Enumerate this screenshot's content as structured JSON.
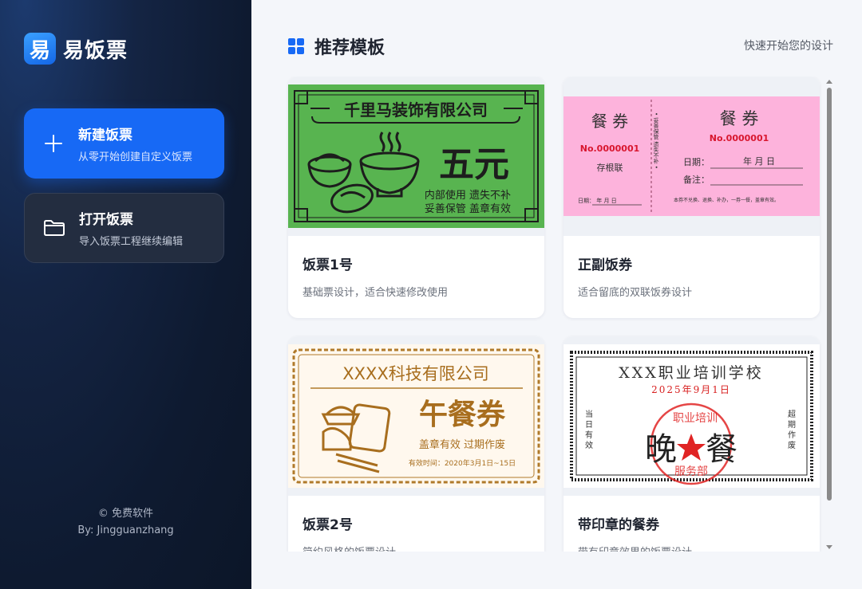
{
  "app": {
    "logo_glyph": "易",
    "name": "易饭票"
  },
  "sidebar": {
    "new_ticket": {
      "title": "新建饭票",
      "subtitle": "从零开始创建自定义饭票"
    },
    "open_ticket": {
      "title": "打开饭票",
      "subtitle": "导入饭票工程继续编辑"
    },
    "footer_line1": "© 免费软件",
    "footer_line2": "By: Jingguanzhang"
  },
  "main": {
    "title": "推荐模板",
    "hint": "快速开始您的设计",
    "templates": [
      {
        "name": "饭票1号",
        "desc": "基础票设计，适合快速修改使用",
        "preview": {
          "company": "千里马装饰有限公司",
          "amount": "五元",
          "line1": "内部使用 遗失不补",
          "line2": "妥善保管 盖章有效"
        }
      },
      {
        "name": "正副饭券",
        "desc": "适合留底的双联饭券设计",
        "preview": {
          "stub_title": "餐 券",
          "stub_no": "No.0000001",
          "stub_label": "存根联",
          "stub_date": "日期：    年  月  日",
          "side_text": "• 妥善保管 遗失不补 •",
          "main_title": "餐   券",
          "main_no": "No.0000001",
          "date_label": "日期：",
          "date_fields": "年    月    日",
          "note_label": "备注：",
          "fine_print": "本券不兑换、退换、补办，一券一餐，盖章有效。"
        }
      },
      {
        "name": "饭票2号",
        "desc": "简约风格的饭票设计",
        "preview": {
          "company": "XXXX科技有限公司",
          "title": "午餐券",
          "line1": "盖章有效 过期作废",
          "validity": "有效时间：2020年3月1日~15日"
        }
      },
      {
        "name": "带印章的餐券",
        "desc": "带有印章效果的饭票设计",
        "preview": {
          "school": "XXX职业培训学校",
          "date": "2025年9月1日",
          "left_note": "当日有效",
          "right_note": "超期作废",
          "meal_left": "晚",
          "meal_right": "餐",
          "seal_top": "职业培训",
          "seal_bottom": "服务部"
        }
      }
    ]
  },
  "colors": {
    "accent": "#1769f5",
    "ticket1_green": "#58b450",
    "ticket2_pink": "#fdb3dc",
    "ticket3_brown": "#b07a2a",
    "seal_red": "#e02424"
  }
}
